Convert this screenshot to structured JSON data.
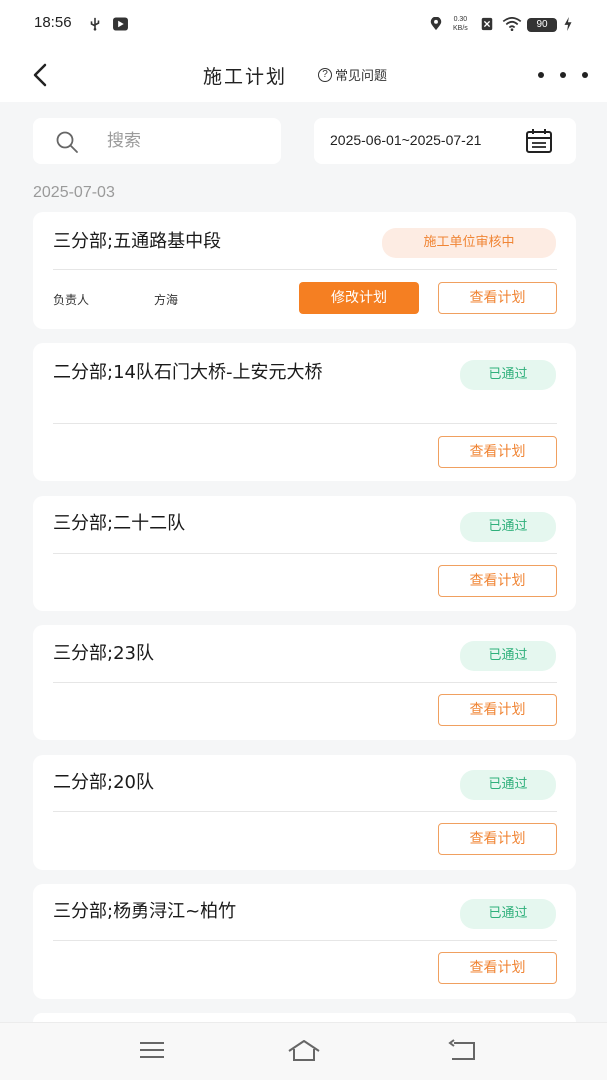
{
  "status_bar": {
    "time": "18:56",
    "net_speed_top": "0.30",
    "net_speed_bottom": "KB/s",
    "battery": "90"
  },
  "nav": {
    "title": "施工计划",
    "faq_label": "常见问题",
    "faq_icon": "?"
  },
  "search": {
    "placeholder": "搜索"
  },
  "date_range": "2025-06-01~2025-07-21",
  "group_date": "2025-07-03",
  "cards": [
    {
      "title": "三分部;五通路基中段",
      "status": "施工单位审核中",
      "owner_label": "负责人",
      "owner_value": "方海",
      "edit_label": "修改计划",
      "view_label": "查看计划"
    },
    {
      "title": "二分部;14队石门大桥-上安元大桥",
      "status": "已通过",
      "view_label": "查看计划"
    },
    {
      "title": "三分部;二十二队",
      "status": "已通过",
      "view_label": "查看计划"
    },
    {
      "title": "三分部;23队",
      "status": "已通过",
      "view_label": "查看计划"
    },
    {
      "title": "二分部;20队",
      "status": "已通过",
      "view_label": "查看计划"
    },
    {
      "title": "三分部;杨勇浔江~柏竹",
      "status": "已通过",
      "view_label": "查看计划"
    }
  ],
  "colors": {
    "accent": "#f57f22",
    "pending": "#f08535",
    "approved": "#2fb07b",
    "background": "#f5f6f7"
  }
}
